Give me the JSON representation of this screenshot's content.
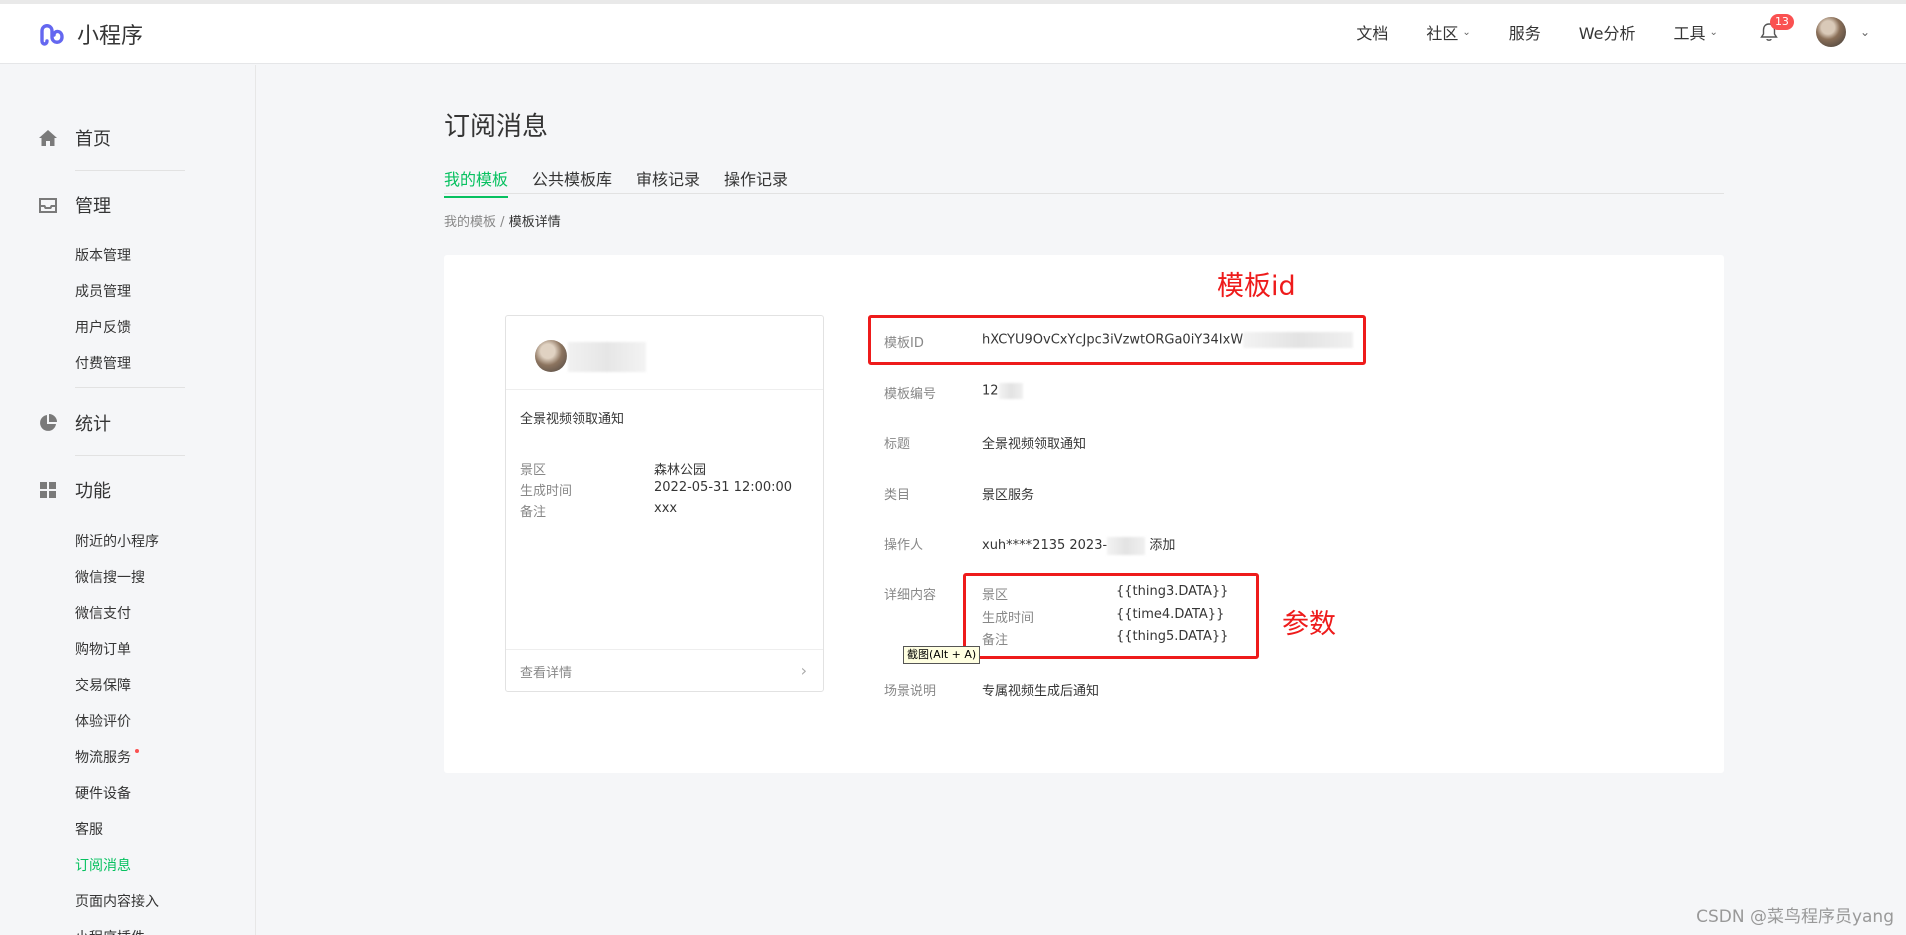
{
  "brand": {
    "name": "小程序"
  },
  "topnav": {
    "items": [
      {
        "label": "文档",
        "has_dropdown": false
      },
      {
        "label": "社区",
        "has_dropdown": true
      },
      {
        "label": "服务",
        "has_dropdown": false
      },
      {
        "label": "We分析",
        "has_dropdown": false
      },
      {
        "label": "工具",
        "has_dropdown": true
      }
    ],
    "notification_count": "13",
    "chevron": "⌄"
  },
  "sidebar": {
    "home": "首页",
    "manage": {
      "label": "管理",
      "items": [
        "版本管理",
        "成员管理",
        "用户反馈",
        "付费管理"
      ]
    },
    "stats": "统计",
    "features": {
      "label": "功能",
      "items": [
        "附近的小程序",
        "微信搜一搜",
        "微信支付",
        "购物订单",
        "交易保障",
        "体验评价",
        "物流服务",
        "硬件设备",
        "客服",
        "订阅消息",
        "页面内容接入",
        "小程序插件"
      ],
      "active": "订阅消息"
    }
  },
  "main": {
    "title": "订阅消息",
    "tabs": [
      "我的模板",
      "公共模板库",
      "审核记录",
      "操作记录"
    ],
    "active_tab": "我的模板",
    "breadcrumb": {
      "parent": "我的模板",
      "sep": "/",
      "current": "模板详情"
    }
  },
  "preview": {
    "title": "全景视频领取通知",
    "rows": [
      {
        "key": "景区",
        "value": "森林公园"
      },
      {
        "key": "生成时间",
        "value": "2022-05-31 12:00:00"
      },
      {
        "key": "备注",
        "value": "xxx"
      }
    ],
    "footer": "查看详情",
    "arrow": "›"
  },
  "details": {
    "template_id_label": "模板ID",
    "template_id_value": "hXCYU9OvCxYcJpc3iVzwtORGa0iY34IxW",
    "number_label": "模板编号",
    "number_value": "12",
    "title_label": "标题",
    "title_value": "全景视频领取通知",
    "category_label": "类目",
    "category_value": "景区服务",
    "operator_label": "操作人",
    "operator_value": "xuh****2135 2023-",
    "operator_suffix": "添加",
    "content_label": "详细内容",
    "params": [
      {
        "key": "景区",
        "value": "{{thing3.DATA}}"
      },
      {
        "key": "生成时间",
        "value": "{{time4.DATA}}"
      },
      {
        "key": "备注",
        "value": "{{thing5.DATA}}"
      }
    ],
    "scene_label": "场景说明",
    "scene_value": "专属视频生成后通知"
  },
  "annotations": {
    "template_id": "模板id",
    "params": "参数",
    "color": "#ee1b1b"
  },
  "tooltip": "截图(Alt + A)",
  "watermark": "CSDN @菜鸟程序员yang",
  "colors": {
    "accent": "#07c160",
    "badge": "#fa5151"
  }
}
